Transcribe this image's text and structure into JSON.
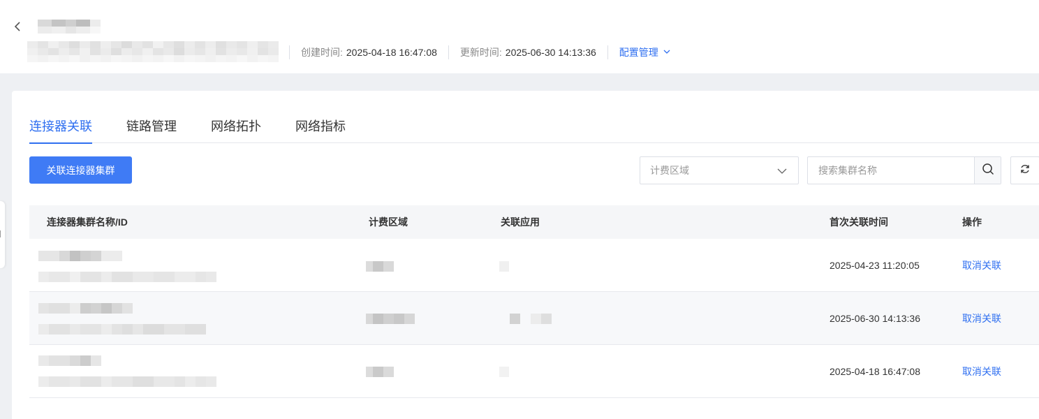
{
  "header": {
    "meta": {
      "created_label": "创建时间:",
      "created_value": "2025-04-18 16:47:08",
      "updated_label": "更新时间:",
      "updated_value": "2025-06-30 14:13:36",
      "config_link": "配置管理"
    }
  },
  "tabs": [
    {
      "label": "连接器关联",
      "active": true
    },
    {
      "label": "链路管理",
      "active": false
    },
    {
      "label": "网络拓扑",
      "active": false
    },
    {
      "label": "网络指标",
      "active": false
    }
  ],
  "toolbar": {
    "primary_button": "关联连接器集群",
    "region_select_placeholder": "计费区域",
    "search_placeholder": "搜索集群名称"
  },
  "table": {
    "columns": [
      "连接器集群名称/ID",
      "计费区域",
      "关联应用",
      "首次关联时间",
      "操作"
    ],
    "rows": [
      {
        "first_linked": "2025-04-23 11:20:05",
        "action": "取消关联"
      },
      {
        "first_linked": "2025-06-30 14:13:36",
        "action": "取消关联"
      },
      {
        "first_linked": "2025-04-18 16:47:08",
        "action": "取消关联"
      }
    ]
  },
  "colors": {
    "accent": "#2f6ff0",
    "primary_button": "#3f7bf5",
    "page_bg": "#eef0f3",
    "table_header_bg": "#f5f6f8"
  },
  "icons": {
    "back": "chevron-left-icon",
    "config_dropdown": "chevron-down-icon",
    "select_arrow": "chevron-down-icon",
    "search": "search-icon",
    "refresh": "refresh-icon"
  }
}
